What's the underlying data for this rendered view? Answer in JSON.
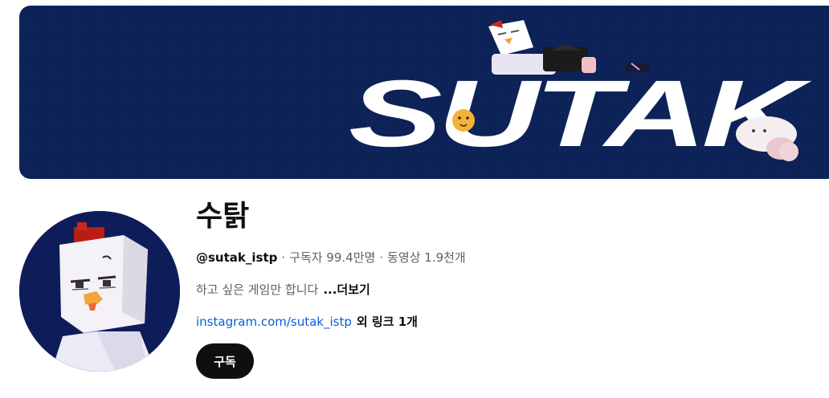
{
  "banner": {
    "logo_text": "SUTAK",
    "background_color": "#0d2257"
  },
  "channel": {
    "name": "수탉",
    "handle": "@sutak_istp",
    "subscribers": "구독자 99.4만명",
    "videos": "동영상 1.9천개",
    "separator": "·",
    "description": "하고 싶은 게임만 합니다",
    "more_label": "...더보기",
    "link_text": "instagram.com/sutak_istp",
    "extra_links": "외 링크 1개",
    "subscribe_label": "구독"
  },
  "colors": {
    "link": "#065fd4",
    "subscribe_bg": "#0f0f0f",
    "meta_text": "#606060"
  }
}
